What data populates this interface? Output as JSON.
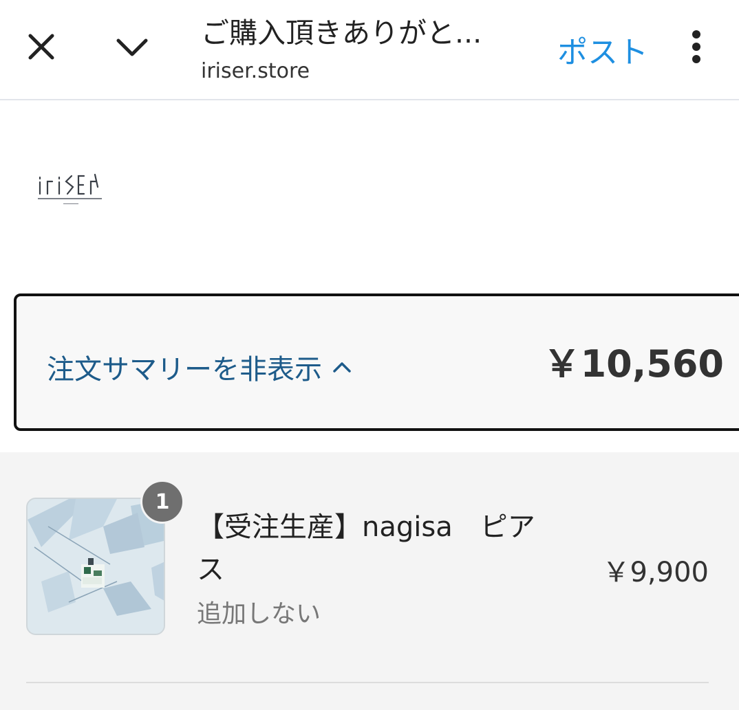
{
  "header": {
    "title": "ご購入頂きありがと...",
    "domain": "iriser.store",
    "post_label": "ポスト",
    "close_icon": "close-icon",
    "collapse_icon": "chevron-down-icon",
    "menu_icon": "more-vert-icon",
    "post_color": "#1e8fe1"
  },
  "brand": {
    "logo_text": "iriser"
  },
  "summary": {
    "toggle_label": "注文サマリーを非表示",
    "toggle_icon": "chevron-up-icon",
    "total": "￥10,560",
    "link_color": "#1d5b8a"
  },
  "items": [
    {
      "quantity": "1",
      "name": "【受注生産】nagisa　ピアス",
      "variant": "追加しない",
      "price": "￥9,900"
    }
  ]
}
